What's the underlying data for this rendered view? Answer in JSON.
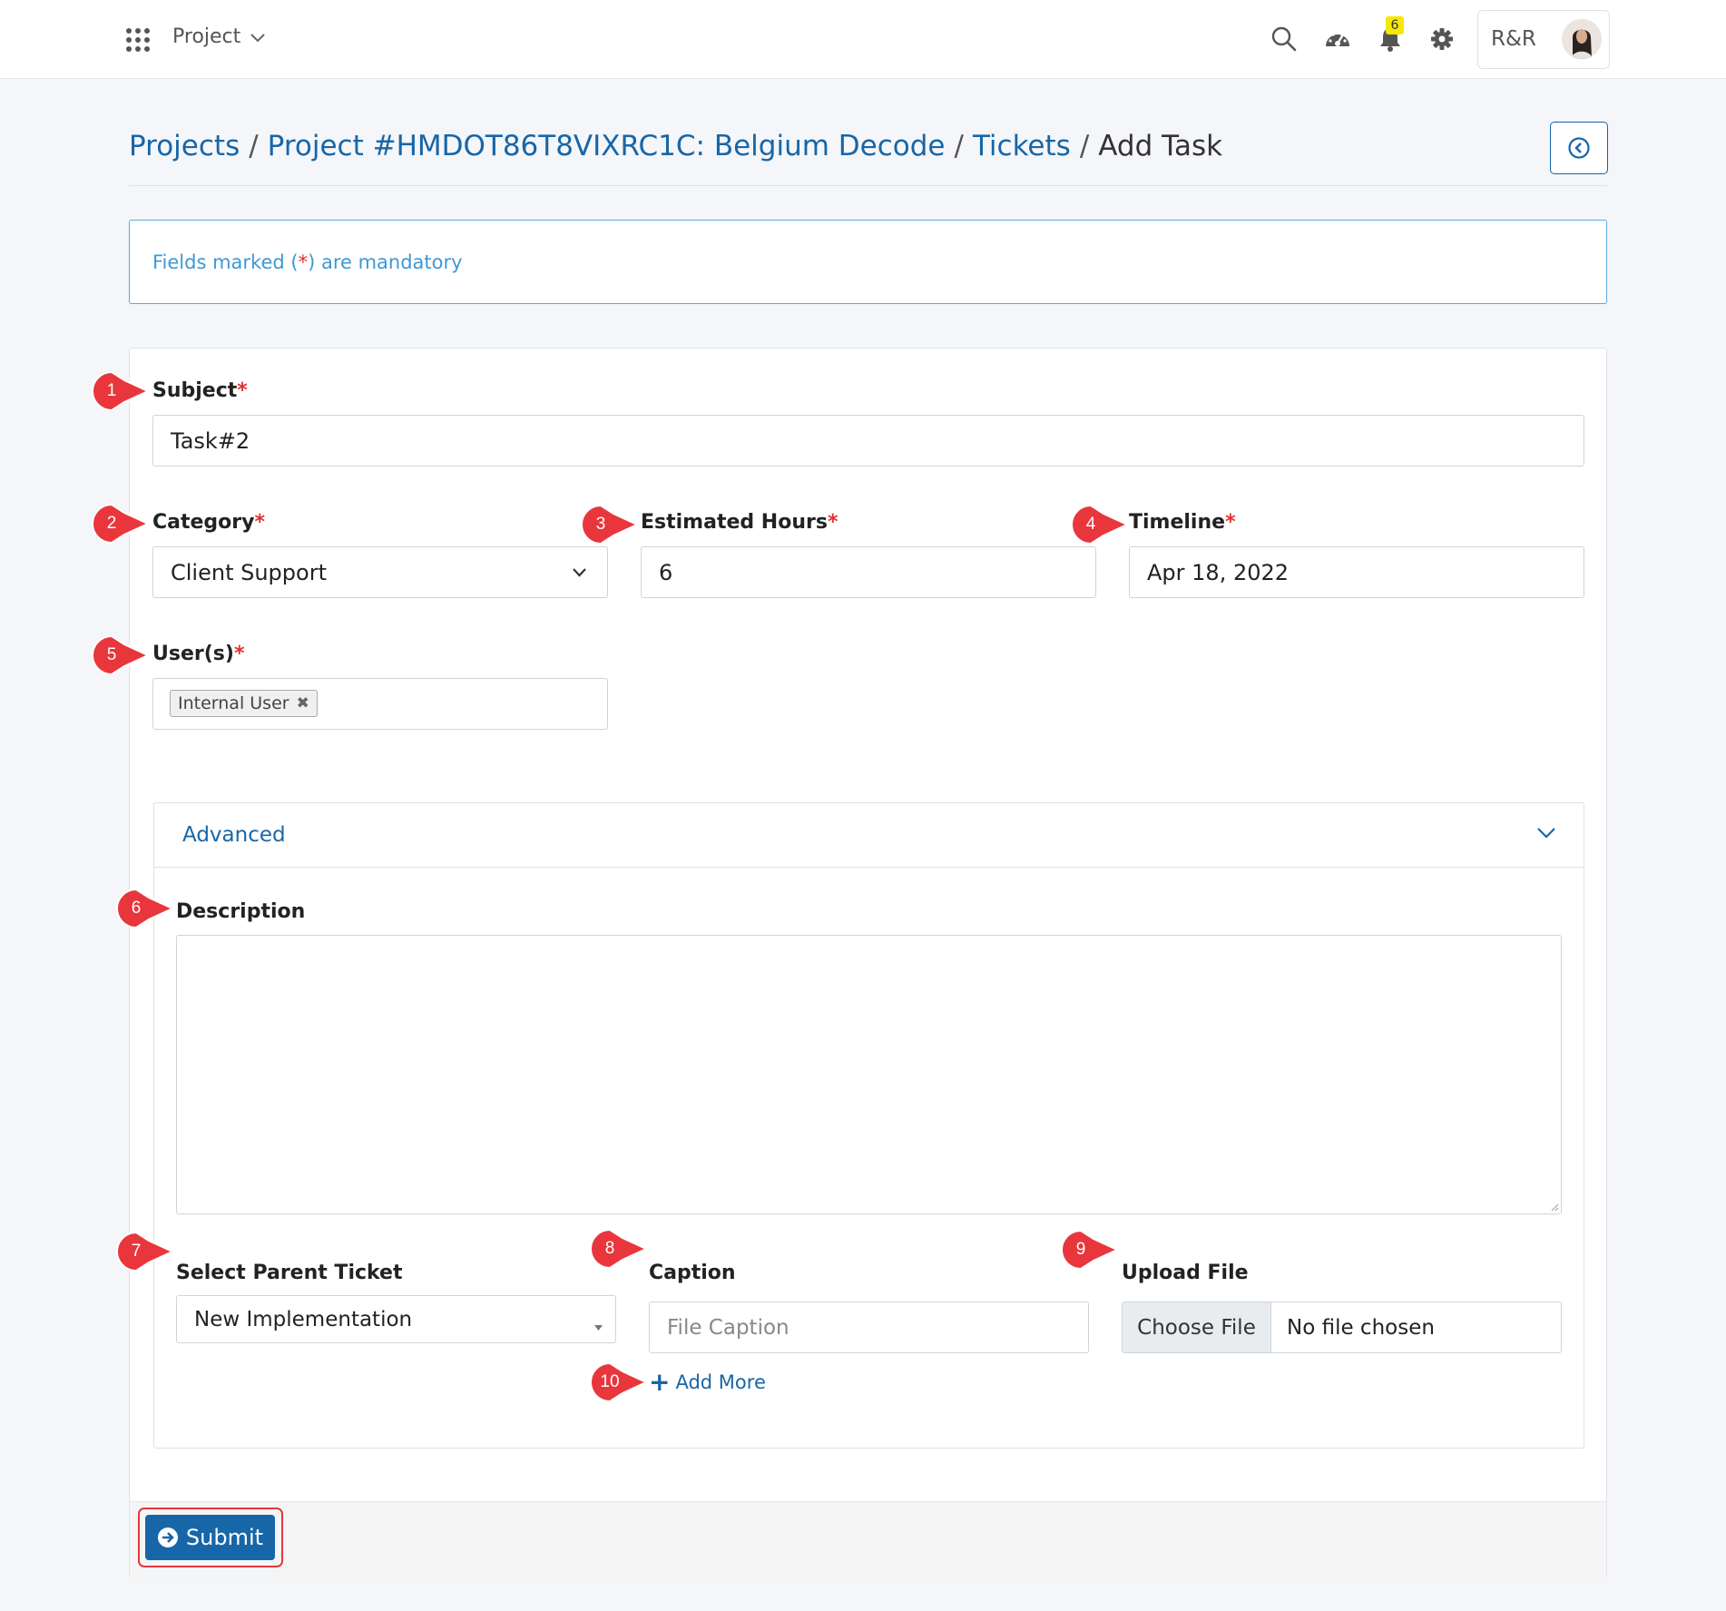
{
  "topbar": {
    "menu_label": "Project",
    "notification_count": "6",
    "user_label": "R&R"
  },
  "breadcrumb": {
    "items": [
      "Projects",
      "Project #HMDOT86T8VIXRC1C: Belgium Decode",
      "Tickets"
    ],
    "current": "Add Task"
  },
  "info": {
    "prefix": "Fields marked (",
    "star": "*",
    "suffix": ") are mandatory"
  },
  "form": {
    "subject": {
      "label": "Subject",
      "value": "Task#2"
    },
    "category": {
      "label": "Category",
      "value": "Client Support"
    },
    "estimated_hours": {
      "label": "Estimated Hours",
      "value": "6"
    },
    "timeline": {
      "label": "Timeline",
      "value": "Apr 18, 2022"
    },
    "users": {
      "label": "User(s)",
      "tags": [
        "Internal User"
      ]
    },
    "required_mark": "*"
  },
  "advanced": {
    "title": "Advanced",
    "description": {
      "label": "Description",
      "value": ""
    },
    "parent_ticket": {
      "label": "Select Parent Ticket",
      "value": "New Implementation"
    },
    "caption": {
      "label": "Caption",
      "placeholder": "File Caption"
    },
    "upload": {
      "label": "Upload File",
      "button": "Choose File",
      "status": "No file chosen"
    },
    "add_more": "Add More"
  },
  "footer": {
    "submit_label": "Submit"
  },
  "markers": [
    "1",
    "2",
    "3",
    "4",
    "5",
    "6",
    "7",
    "8",
    "9",
    "10"
  ],
  "colors": {
    "link": "#1766a8",
    "required": "#e03131",
    "marker": "#e8363c",
    "info_text": "#3f98d6",
    "badge": "#f6e800"
  }
}
